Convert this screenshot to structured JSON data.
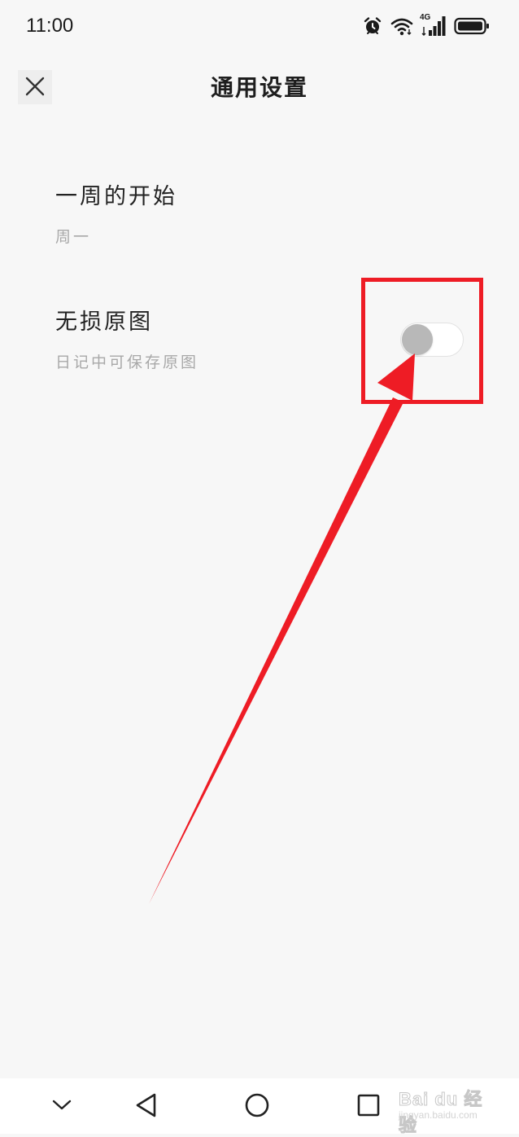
{
  "status_bar": {
    "time": "11:00",
    "network": "4G",
    "icons": [
      "alarm-icon",
      "wifi-icon",
      "signal-icon",
      "battery-icon"
    ]
  },
  "header": {
    "title": "通用设置",
    "close_icon": "close-icon"
  },
  "settings": [
    {
      "title": "一周的开始",
      "subtitle": "周一"
    },
    {
      "title": "无损原图",
      "subtitle": "日记中可保存原图",
      "toggle_on": false
    }
  ],
  "annotation": {
    "color": "#ee1c25"
  },
  "nav_bar": {
    "icons": [
      "chevron-down-icon",
      "back-triangle-icon",
      "home-circle-icon",
      "recents-square-icon"
    ]
  },
  "watermark": {
    "main": "Bai du 经验",
    "sub": "jingyan.baidu.com"
  },
  "colors": {
    "background": "#f7f7f7",
    "title": "#222222",
    "subtitle": "#a8a8a8",
    "toggle_knob_off": "#b8b8b8"
  }
}
